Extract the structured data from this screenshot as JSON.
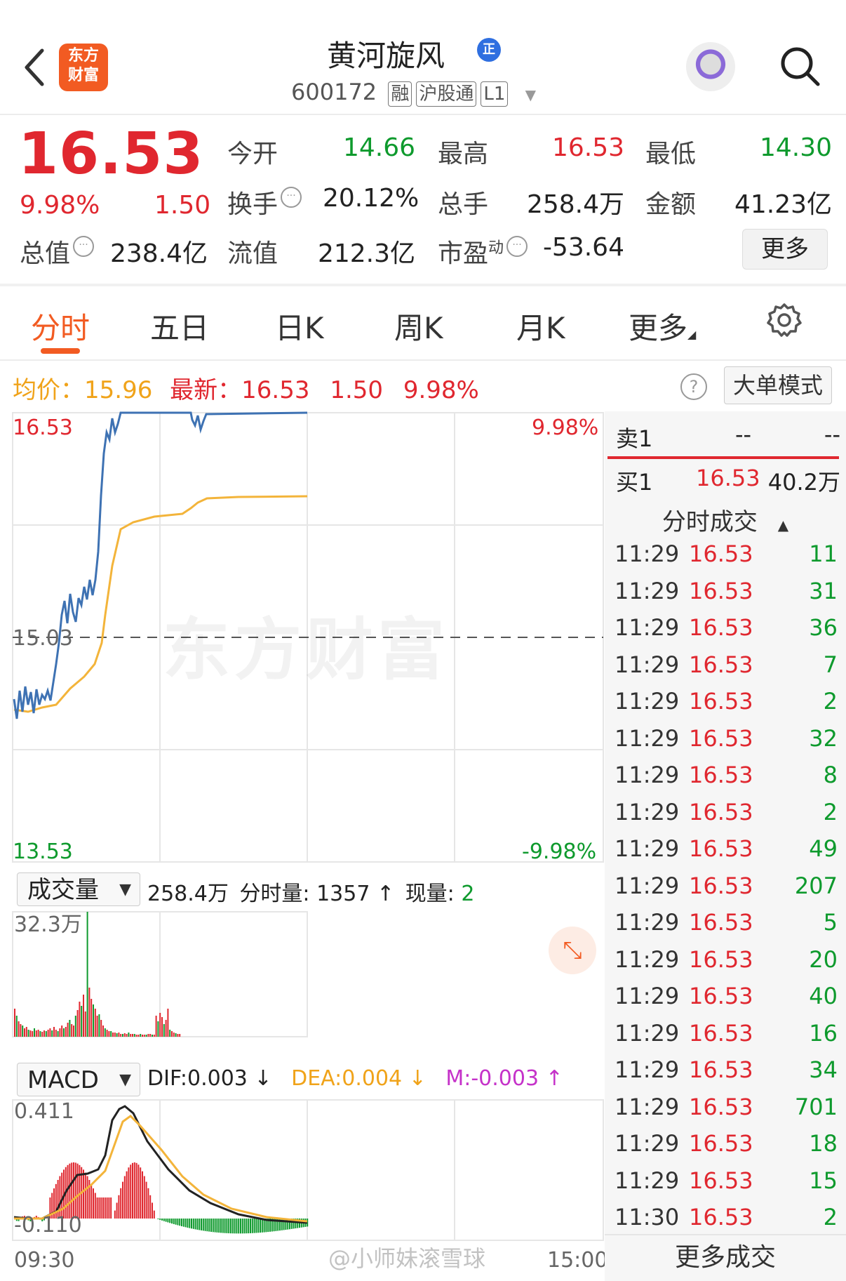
{
  "header": {
    "back_icon": "chevron-left",
    "logo_line1": "东方",
    "logo_line2": "财富",
    "stock_name": "黄河旋风",
    "verified_badge": "正",
    "stock_code": "600172",
    "tags": [
      "融",
      "沪股通",
      "L1"
    ]
  },
  "quote": {
    "price": "16.53",
    "change_pct": "9.98%",
    "change_amt": "1.50",
    "open_label": "今开",
    "open": "14.66",
    "high_label": "最高",
    "high": "16.53",
    "low_label": "最低",
    "low": "14.30",
    "turnover_label": "换手",
    "turnover": "20.12%",
    "volume_label": "总手",
    "volume": "258.4万",
    "amount_label": "金额",
    "amount": "41.23亿",
    "mktcap_label": "总值",
    "mktcap": "238.4亿",
    "float_label": "流值",
    "float": "212.3亿",
    "pe_label": "市盈",
    "pe_sup": "动",
    "pe": "-53.64",
    "more_label": "更多",
    "colors": {
      "up": "#e0272f",
      "down": "#0e9a2d",
      "accent": "#f25b22"
    }
  },
  "tabs": {
    "items": [
      "分时",
      "五日",
      "日K",
      "周K",
      "月K",
      "更多"
    ],
    "active": "分时"
  },
  "info_line": {
    "avg_label": "均价：",
    "avg": "15.96",
    "latest_label": "最新：",
    "latest": "16.53",
    "chg": "1.50",
    "pct": "9.98%",
    "help_icon": "?",
    "big_order_label": "大单模式"
  },
  "chart": {
    "y_top": "16.53",
    "y_mid": "15.03",
    "y_bottom": "13.53",
    "pct_top": "9.98%",
    "pct_bottom": "-9.98%",
    "watermark": "东方财富",
    "vol_select": "成交量",
    "vol_total": "258.4万",
    "vol_minute_label": "分时量:",
    "vol_minute": "1357",
    "vol_now_label": "现量:",
    "vol_now": "2",
    "vol_max": "32.3万",
    "macd_select": "MACD",
    "dif": "DIF:0.003 ↓",
    "dea": "DEA:0.004 ↓",
    "m": "M:-0.003 ↑",
    "macd_top": "0.411",
    "macd_bottom": "-0.110",
    "time_start": "09:30",
    "time_end": "15:00"
  },
  "chart_data": {
    "type": "line",
    "series": [
      {
        "name": "最新",
        "x": [
          "09:30",
          "09:40",
          "09:50",
          "10:00",
          "10:10",
          "10:20",
          "10:30",
          "10:40",
          "10:50",
          "11:00",
          "11:10",
          "11:20",
          "11:30"
        ],
        "values": [
          14.7,
          14.75,
          14.78,
          15.2,
          15.35,
          16.1,
          16.53,
          16.53,
          16.53,
          16.5,
          16.53,
          16.53,
          16.53
        ]
      },
      {
        "name": "均价",
        "x": [
          "09:30",
          "09:40",
          "09:50",
          "10:00",
          "10:10",
          "10:20",
          "10:30",
          "10:40",
          "10:50",
          "11:00",
          "11:10",
          "11:20",
          "11:30"
        ],
        "values": [
          14.7,
          14.72,
          14.82,
          14.92,
          15.1,
          15.8,
          15.85,
          15.87,
          15.88,
          15.92,
          15.95,
          15.96,
          15.96
        ]
      }
    ],
    "ylim": [
      13.53,
      16.53
    ],
    "reference": 15.03
  },
  "panel": {
    "sell1_label": "卖1",
    "sell1_price": "--",
    "sell1_vol": "--",
    "buy1_label": "买1",
    "buy1_price": "16.53",
    "buy1_vol": "40.2万",
    "trades_title": "分时成交",
    "trades": [
      {
        "t": "11:29",
        "p": "16.53",
        "v": "11"
      },
      {
        "t": "11:29",
        "p": "16.53",
        "v": "31"
      },
      {
        "t": "11:29",
        "p": "16.53",
        "v": "36"
      },
      {
        "t": "11:29",
        "p": "16.53",
        "v": "7"
      },
      {
        "t": "11:29",
        "p": "16.53",
        "v": "2"
      },
      {
        "t": "11:29",
        "p": "16.53",
        "v": "32"
      },
      {
        "t": "11:29",
        "p": "16.53",
        "v": "8"
      },
      {
        "t": "11:29",
        "p": "16.53",
        "v": "2"
      },
      {
        "t": "11:29",
        "p": "16.53",
        "v": "49"
      },
      {
        "t": "11:29",
        "p": "16.53",
        "v": "207"
      },
      {
        "t": "11:29",
        "p": "16.53",
        "v": "5"
      },
      {
        "t": "11:29",
        "p": "16.53",
        "v": "20"
      },
      {
        "t": "11:29",
        "p": "16.53",
        "v": "40"
      },
      {
        "t": "11:29",
        "p": "16.53",
        "v": "16"
      },
      {
        "t": "11:29",
        "p": "16.53",
        "v": "34"
      },
      {
        "t": "11:29",
        "p": "16.53",
        "v": "701"
      },
      {
        "t": "11:29",
        "p": "16.53",
        "v": "18"
      },
      {
        "t": "11:29",
        "p": "16.53",
        "v": "15"
      },
      {
        "t": "11:30",
        "p": "16.53",
        "v": "2"
      }
    ],
    "more_trades_label": "更多成交"
  },
  "overlay_watermark": "@小师妹滚雪球"
}
